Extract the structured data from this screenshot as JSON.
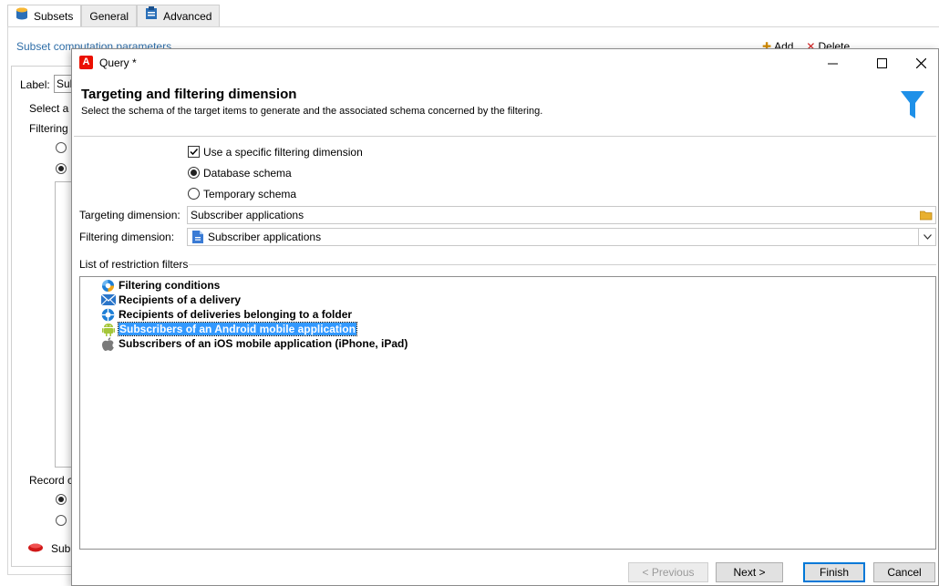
{
  "background": {
    "tabs": [
      {
        "label": "Subsets",
        "icon": "database-icon",
        "active": true
      },
      {
        "label": "General",
        "active": false
      },
      {
        "label": "Advanced",
        "icon": "clipboard-icon",
        "active": false
      }
    ],
    "subheader": "Subset computation parameters",
    "toolbar": {
      "add_label": "Add",
      "delete_label": "Delete"
    },
    "label_caption": "Label:",
    "label_value": "Sub",
    "select_text": "Select a s",
    "filtering_text": "Filtering",
    "record_text": "Record c",
    "footer_item": "Sub"
  },
  "dialog": {
    "window_title": "Query *",
    "header_title": "Targeting and filtering dimension",
    "header_subtitle": "Select the schema of the target items to  generate and the associated schema concerned by the filtering.",
    "use_specific_label": "Use a specific filtering dimension",
    "use_specific_checked": true,
    "database_schema_label": "Database schema",
    "temporary_schema_label": "Temporary schema",
    "schema_selected": "Database schema",
    "targeting_label": "Targeting dimension:",
    "targeting_value": "Subscriber applications",
    "filtering_label": "Filtering dimension:",
    "filtering_value": "Subscriber applications",
    "list_group_label": "List of restriction filters",
    "filters": [
      {
        "label": "Filtering conditions",
        "icon": "filter-conditions-icon"
      },
      {
        "label": "Recipients of a delivery",
        "icon": "envelope-icon"
      },
      {
        "label": "Recipients of deliveries belonging to a folder",
        "icon": "folder-delivery-icon"
      },
      {
        "label": "Subscribers of an Android mobile application",
        "icon": "android-icon",
        "selected": true
      },
      {
        "label": "Subscribers of an iOS mobile application (iPhone, iPad)",
        "icon": "apple-icon"
      }
    ],
    "buttons": {
      "previous": "< Previous",
      "next": "Next >",
      "finish": "Finish",
      "cancel": "Cancel"
    }
  },
  "colors": {
    "accent": "#0078d7",
    "selection": "#3399ff",
    "brand": "#eb1000",
    "link": "#2f6ea8"
  }
}
